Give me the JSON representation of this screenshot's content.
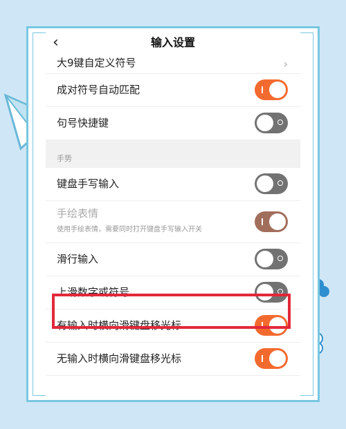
{
  "header": {
    "back_icon": "chevron-left-icon",
    "back_glyph": "‹",
    "title": "输入设置"
  },
  "rows_top": [
    {
      "label": "大9键自定义符号",
      "control": "chevron",
      "glyph": "›"
    },
    {
      "label": "成对符号自动匹配",
      "control": "toggle",
      "state": "on"
    },
    {
      "label": "句号快捷键",
      "control": "toggle",
      "state": "off"
    }
  ],
  "section": {
    "title": "手势"
  },
  "rows_bottom": [
    {
      "label": "键盘手写输入",
      "control": "toggle",
      "state": "off"
    },
    {
      "label": "手绘表情",
      "sublabel": "使用手绘表情，需要同时打开键盘手写输入开关",
      "control": "toggle",
      "state": "on",
      "disabled": true
    },
    {
      "label": "滑行输入",
      "control": "toggle",
      "state": "off"
    },
    {
      "label": "上滑数字或符号",
      "control": "toggle",
      "state": "off",
      "highlighted": true
    },
    {
      "label": "有输入时横向滑键盘移光标",
      "control": "toggle",
      "state": "on"
    },
    {
      "label": "无输入时横向滑键盘移光标",
      "control": "toggle",
      "state": "on"
    }
  ],
  "colors": {
    "toggle_on": "#f36a2f",
    "toggle_off": "#727272",
    "highlight": "#e2283a",
    "frame": "#78c7e0",
    "background": "#cfe6f6"
  }
}
